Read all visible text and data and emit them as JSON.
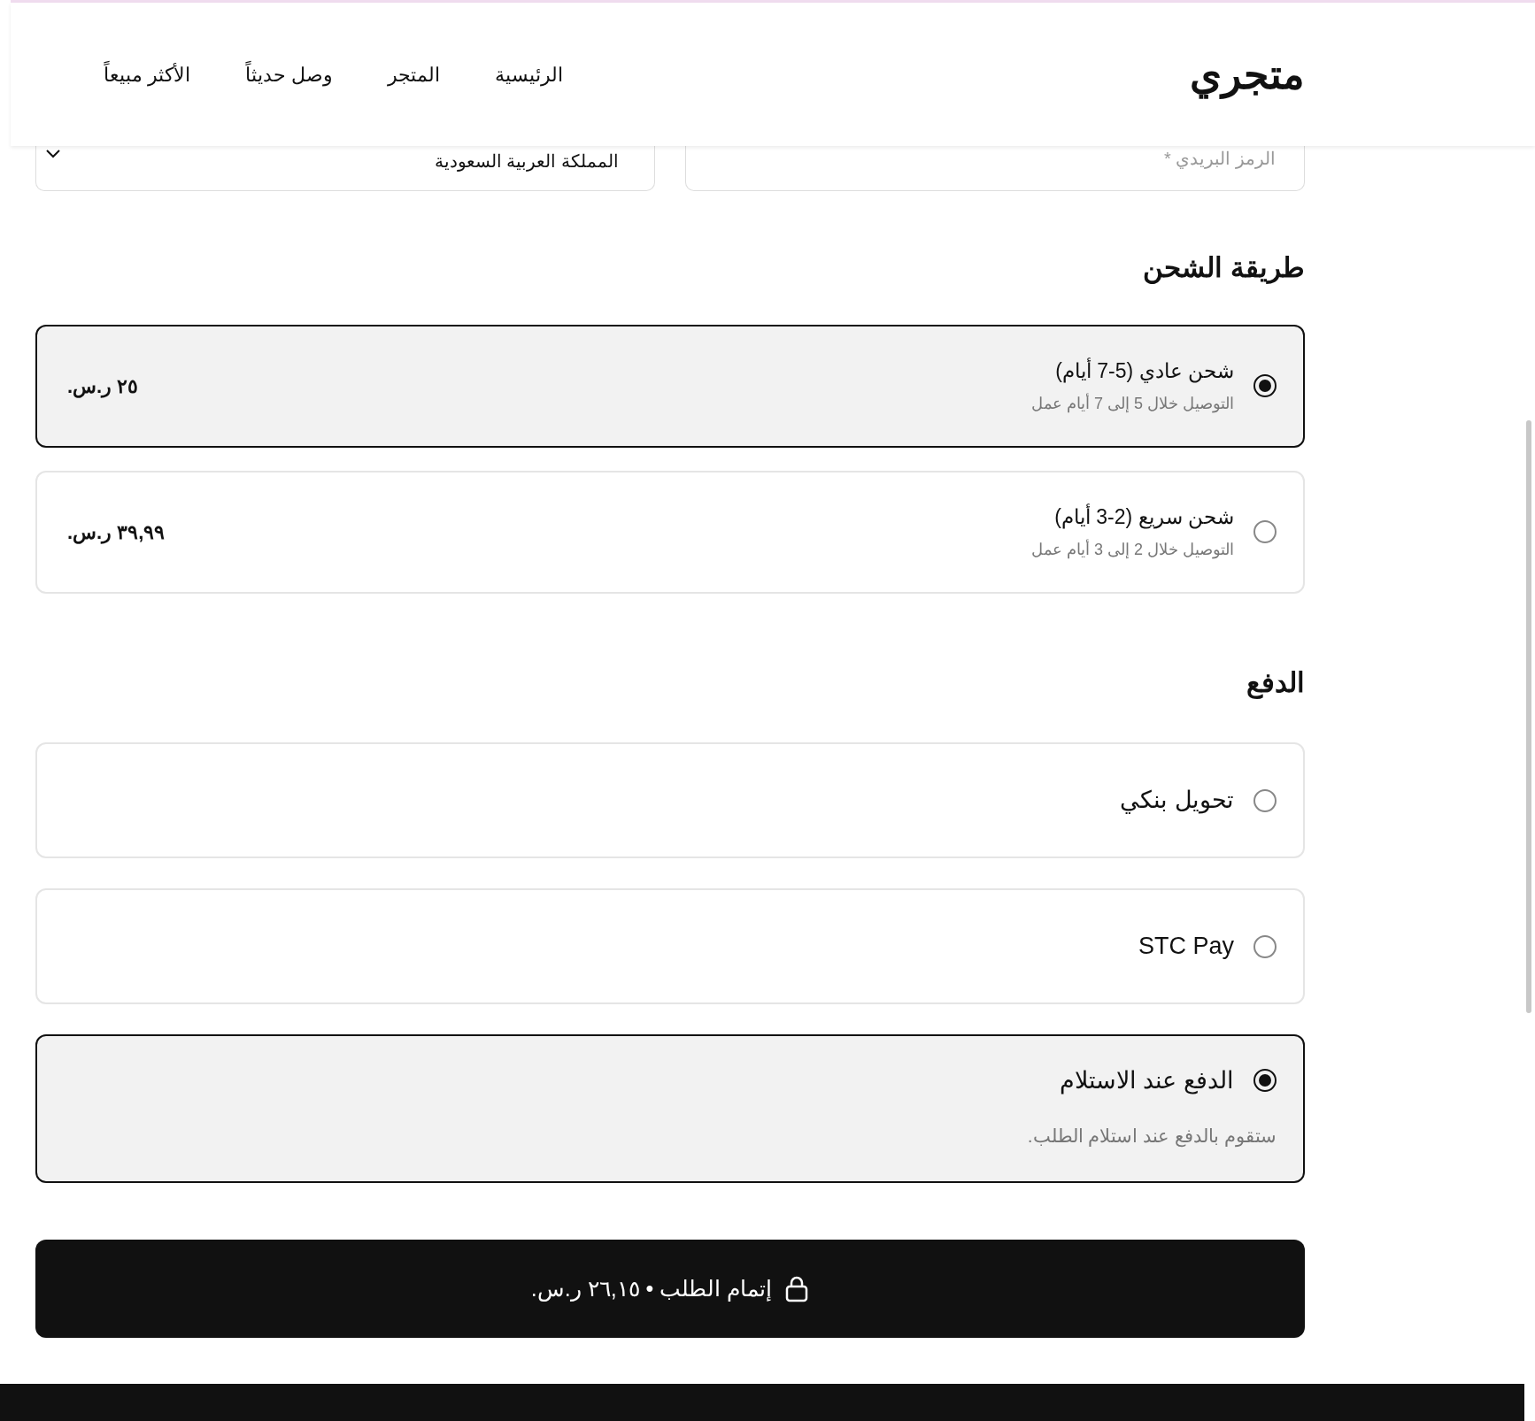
{
  "header": {
    "logo": "متجري",
    "nav": [
      {
        "label": "الرئيسية"
      },
      {
        "label": "المتجر"
      },
      {
        "label": "وصل حديثاً"
      },
      {
        "label": "الأكثر مبيعاً"
      }
    ]
  },
  "address_fields": [
    {
      "kind": "input",
      "placeholder": "الرمز البريدي *"
    },
    {
      "kind": "select",
      "value": "المملكة العربية السعودية"
    }
  ],
  "shipping": {
    "title": "طريقة الشحن",
    "options": [
      {
        "label": "شحن عادي (5-7 أيام)",
        "description": "التوصيل خلال 5 إلى 7 أيام عمل",
        "price": "٢٥ ر.س.",
        "selected": true
      },
      {
        "label": "شحن سريع (2-3 أيام)",
        "description": "التوصيل خلال 2 إلى 3 أيام عمل",
        "price": "٣٩,٩٩ ر.س.",
        "selected": false
      }
    ]
  },
  "payment": {
    "title": "الدفع",
    "options": [
      {
        "label": "تحويل بنكي",
        "selected": false
      },
      {
        "label": "STC Pay",
        "selected": false
      },
      {
        "label": "الدفع عند الاستلام",
        "description": "ستقوم بالدفع عند استلام الطلب.",
        "selected": true
      }
    ]
  },
  "submit_button": "إتمام الطلب • ٢٦,١٥ ر.س."
}
